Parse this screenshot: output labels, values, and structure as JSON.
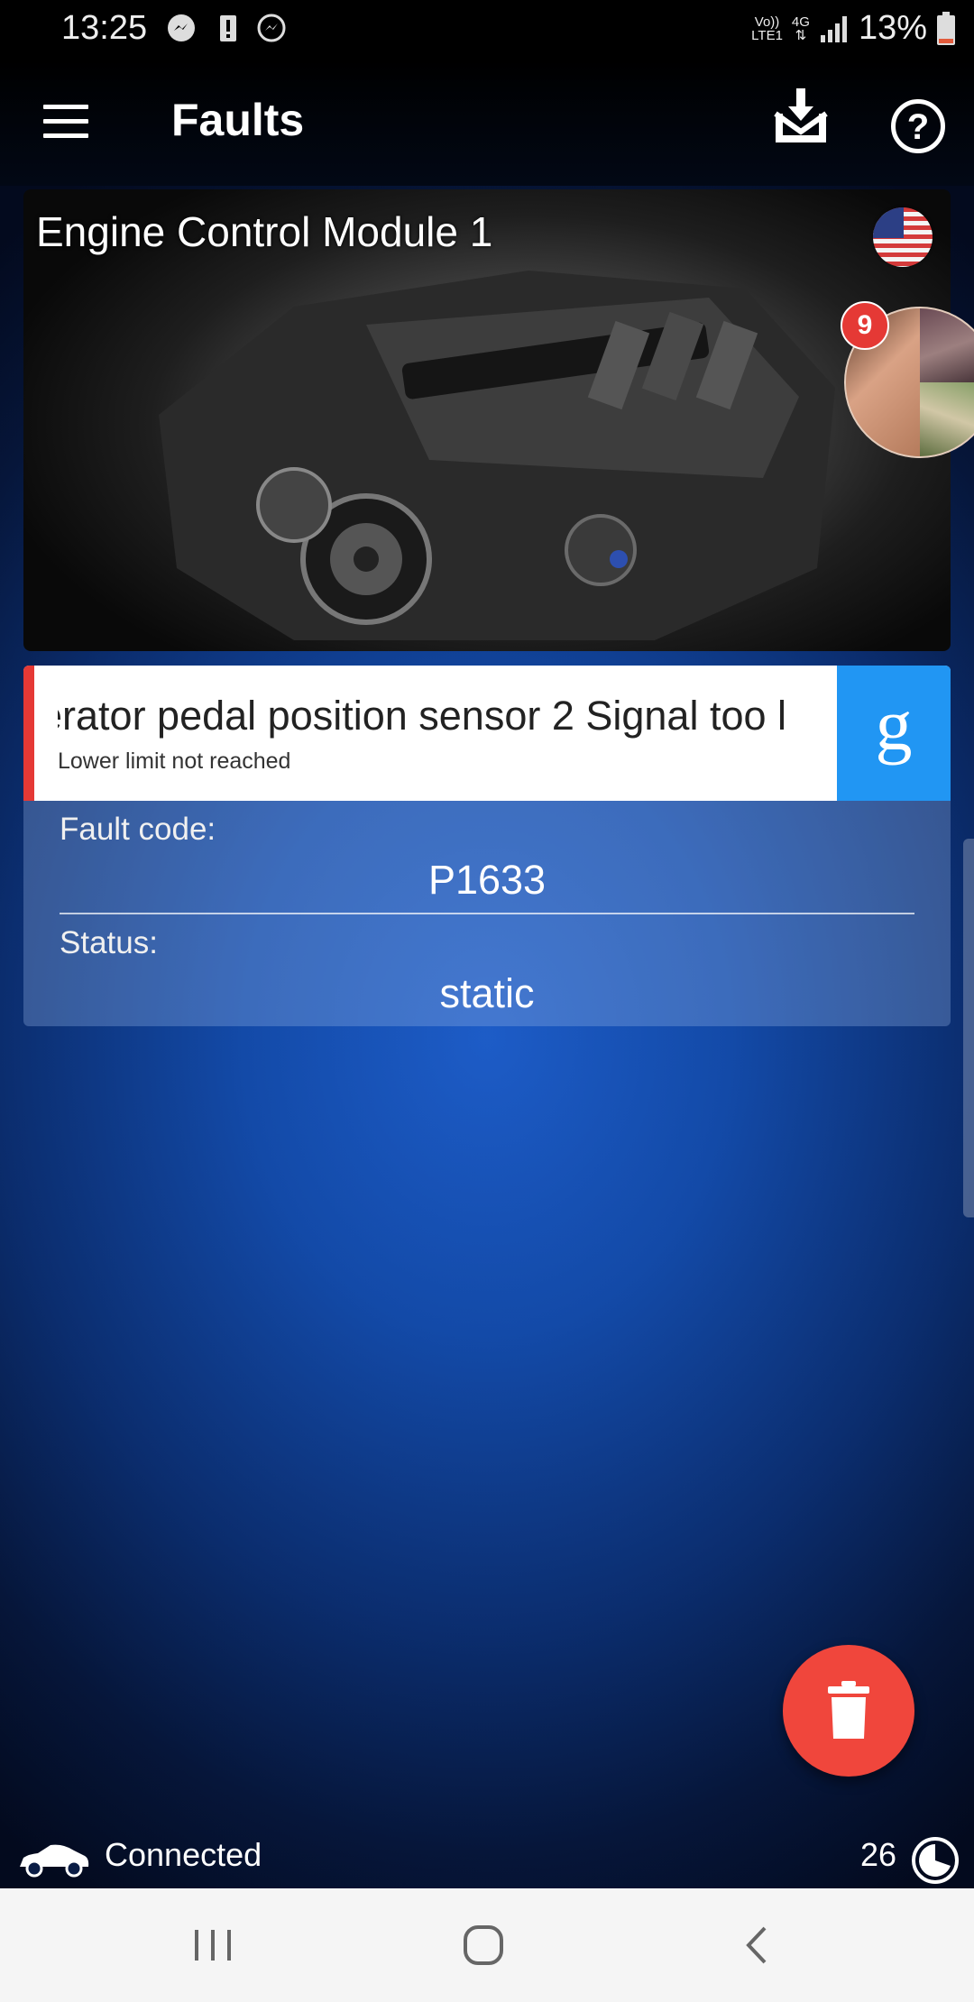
{
  "status_bar": {
    "time": "13:25",
    "network_top": "Vo))",
    "network_sub": "LTE1",
    "network_type": "4G",
    "battery": "13%",
    "icons": [
      "messenger-icon",
      "battery-alert-icon",
      "messenger-icon",
      "signal-icon",
      "battery-icon"
    ]
  },
  "app_bar": {
    "title": "Faults",
    "icons": [
      "menu-icon",
      "download-mail-icon",
      "help-icon"
    ]
  },
  "engine_card": {
    "title": "Engine Control Module 1",
    "flag": "us-flag-icon"
  },
  "chat_head": {
    "badge_count": "9"
  },
  "fault": {
    "description": "erator pedal position sensor 2 Signal too l",
    "subtitle": "Lower limit not reached",
    "google_label": "g",
    "code_label": "Fault code:",
    "code_value": "P1633",
    "status_label": "Status:",
    "status_value": "static"
  },
  "footer": {
    "connection_status": "Connected",
    "count": "26"
  },
  "colors": {
    "accent_red": "#e53935",
    "google_blue": "#2196f3",
    "fab_red": "#f0463c"
  }
}
